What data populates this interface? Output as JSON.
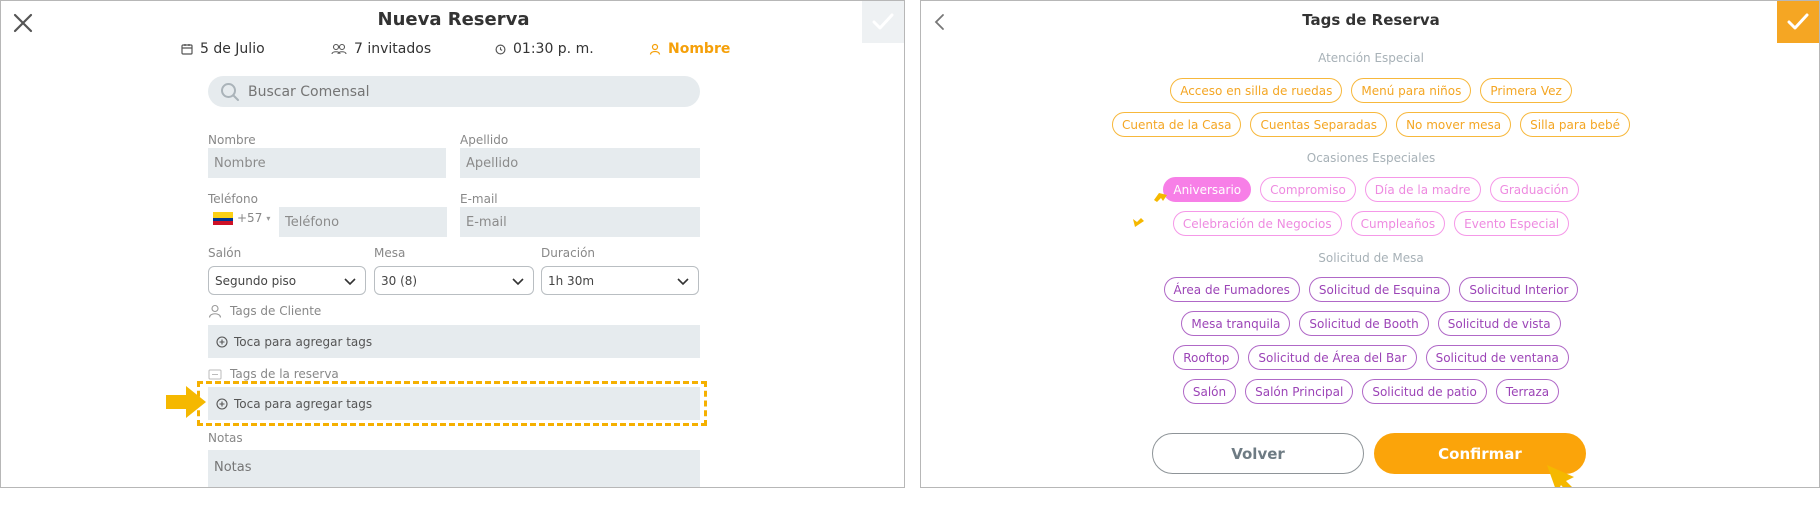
{
  "left": {
    "title": "Nueva Reserva",
    "info": {
      "date": "5 de Julio",
      "guests": "7 invitados",
      "time": "01:30 p. m.",
      "active_step": "Nombre"
    },
    "search_placeholder": "Buscar Comensal",
    "fields": {
      "nombre_label": "Nombre",
      "nombre_placeholder": "Nombre",
      "apellido_label": "Apellido",
      "apellido_placeholder": "Apellido",
      "telefono_label": "Teléfono",
      "country_code": "+57",
      "telefono_placeholder": "Teléfono",
      "email_label": "E-mail",
      "email_placeholder": "E-mail",
      "salon_label": "Salón",
      "salon_value": "Segundo piso",
      "mesa_label": "Mesa",
      "mesa_value": "30 (8)",
      "duracion_label": "Duración",
      "duracion_value": "1h 30m",
      "tags_cliente_label": "Tags de Cliente",
      "tags_cliente_action": "Toca para agregar tags",
      "tags_reserva_label": "Tags de la reserva",
      "tags_reserva_action": "Toca para agregar tags",
      "notas_label": "Notas",
      "notas_placeholder": "Notas"
    }
  },
  "right": {
    "title": "Tags de Reserva",
    "sections": [
      {
        "title": "Atención Especial",
        "rows": [
          [
            "Acceso en silla de ruedas",
            "Menú para niños",
            "Primera Vez"
          ],
          [
            "Cuenta de la Casa",
            "Cuentas Separadas",
            "No mover mesa",
            "Silla para bebé"
          ]
        ]
      },
      {
        "title": "Ocasiones Especiales",
        "rows": [
          [
            "Aniversario",
            "Compromiso",
            "Día de la madre",
            "Graduación"
          ],
          [
            "Celebración de Negocios",
            "Cumpleaños",
            "Evento Especial"
          ]
        ]
      },
      {
        "title": "Solicitud de Mesa",
        "rows": [
          [
            "Área de Fumadores",
            "Solicitud de Esquina",
            "Solicitud Interior"
          ],
          [
            "Mesa tranquila",
            "Solicitud de Booth",
            "Solicitud de vista"
          ],
          [
            "Rooftop",
            "Solicitud de Área del Bar",
            "Solicitud de ventana"
          ],
          [
            "Salón",
            "Salón Principal",
            "Solicitud de patio",
            "Terraza"
          ]
        ]
      }
    ],
    "selected_tag": "Aniversario",
    "buttons": {
      "back": "Volver",
      "confirm": "Confirmar"
    }
  },
  "colors": {
    "accent_orange": "#fba40a",
    "tag_orange": "#f4a623",
    "tag_pink": "#ee8ae0",
    "tag_pink_selected": "#f77fe7",
    "tag_purple": "#9c44b7",
    "highlight_dash": "#f5b000"
  }
}
